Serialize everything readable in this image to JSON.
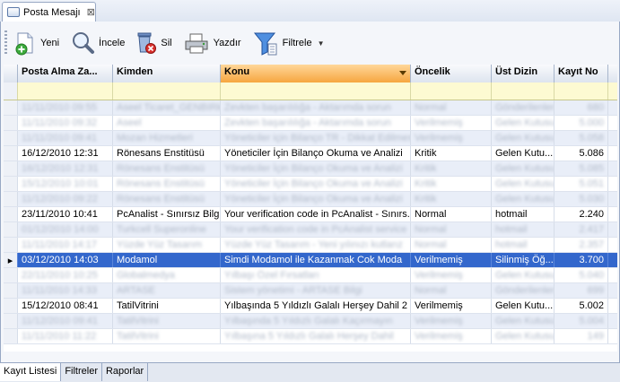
{
  "tab": {
    "title": "Posta Mesajı",
    "close": "⊠"
  },
  "toolbar": {
    "new_label": "Yeni",
    "view_label": "İncele",
    "delete_label": "Sil",
    "print_label": "Yazdır",
    "filter_label": "Filtrele",
    "dropdown_arrow": "▼"
  },
  "grid": {
    "columns": [
      "Posta Alma Za...",
      "Kimden",
      "Konu",
      "Öncelik",
      "Üst Dizin",
      "Kayıt No"
    ],
    "sorted_column": "Konu",
    "rows": [
      {
        "date": "11/11/2010 09:55",
        "from": "Aseel Ticaret_GENBIRk",
        "subject": "Zevkten başarılılığa - Aktarımda sorun",
        "priority": "Normal",
        "folder": "Gönderilenler",
        "num": "680",
        "blur": true
      },
      {
        "date": "11/11/2010 09:32",
        "from": "Aseel",
        "subject": "Zevkten başarılılığa - Aktarımda sorun",
        "priority": "Verilmemiş",
        "folder": "Gelen Kutusu",
        "num": "5.000",
        "blur": true
      },
      {
        "date": "11/11/2010 09:41",
        "from": "Mozan Hizmetleri",
        "subject": "Yöneticiler için Bilanço TR - Dikkat Edilmesi",
        "priority": "Verilmemiş",
        "folder": "Gelen Kutusu",
        "num": "5.058",
        "blur": true
      },
      {
        "date": "16/12/2010 12:31",
        "from": "Rönesans Enstitüsü",
        "subject": "Yöneticiler İçin Bilanço Okuma ve Analizi",
        "priority": "Kritik",
        "folder": "Gelen Kutu...",
        "num": "5.086",
        "blur": false
      },
      {
        "date": "16/12/2010 12:31",
        "from": "Rönesans Enstitüsü",
        "subject": "Yöneticiler İçin Bilanço Okuma ve Analizi",
        "priority": "Kritik",
        "folder": "Gelen Kutusu",
        "num": "5.085",
        "blur": true
      },
      {
        "date": "15/12/2010 10:01",
        "from": "Rönesans Enstitüsü",
        "subject": "Yöneticiler İçin Bilanço Okuma ve Analizi",
        "priority": "Kritik",
        "folder": "Gelen Kutusu",
        "num": "5.051",
        "blur": true
      },
      {
        "date": "11/12/2010 09:22",
        "from": "Rönesans Enstitüsü",
        "subject": "Yöneticiler İçin Bilanço Okuma ve Analizi",
        "priority": "Kritik",
        "folder": "Gelen Kutusu",
        "num": "5.030",
        "blur": true
      },
      {
        "date": "23/11/2010 10:41",
        "from": "PcAnalist - Sınırsız Bilg...",
        "subject": "Your verification code in PcAnalist - Sınırs...",
        "priority": "Normal",
        "folder": "hotmail",
        "num": "2.240",
        "blur": false
      },
      {
        "date": "01/12/2010 14:00",
        "from": "Turkcell Superonline",
        "subject": "Your verification code in PcAnalist service",
        "priority": "Normal",
        "folder": "hotmail",
        "num": "2.417",
        "blur": true
      },
      {
        "date": "11/11/2010 14:17",
        "from": "Yüzde Yüz Tasarım",
        "subject": "Yüzde Yüz Tasarım - Yeni yılınızı kutlarız",
        "priority": "Normal",
        "folder": "hotmail",
        "num": "2.357",
        "blur": true
      },
      {
        "date": "03/12/2010 14:03",
        "from": "Modamol",
        "subject": "Simdi Modamol ile Kazanmak Cok Moda",
        "priority": "Verilmemiş",
        "folder": "Silinmiş Öğ...",
        "num": "3.700",
        "blur": false,
        "selected": true
      },
      {
        "date": "22/11/2010 10:25",
        "from": "Globalmedya",
        "subject": "Yılbaşı Özel Fırsatları",
        "priority": "Verilmemiş",
        "folder": "Gelen Kutusu",
        "num": "5.040",
        "blur": true
      },
      {
        "date": "11/11/2010 14:33",
        "from": "ARTASE",
        "subject": "Sistem yönetimi - ARTASE Bilgi",
        "priority": "Normal",
        "folder": "Gönderilenler",
        "num": "699",
        "blur": true
      },
      {
        "date": "15/12/2010 08:41",
        "from": "TatilVitrini",
        "subject": "Yılbaşında 5 Yıldızlı Galalı Herşey Dahil 2 G...",
        "priority": "Verilmemiş",
        "folder": "Gelen Kutu...",
        "num": "5.002",
        "blur": false
      },
      {
        "date": "11/12/2010 09:41",
        "from": "TatilVitrini",
        "subject": "Yılbaşında 5 Yıldızlı Galalı Kaçırmayın",
        "priority": "Verilmemiş",
        "folder": "Gelen Kutusu",
        "num": "5.004",
        "blur": true
      },
      {
        "date": "11/11/2010 11:22",
        "from": "TatilVitrini",
        "subject": "Yılbaşına 5 Yıldızlı Galalı Herşey Dahil",
        "priority": "Verilmemiş",
        "folder": "Gelen Kutusu",
        "num": "149",
        "blur": true
      }
    ]
  },
  "bottom_tabs": [
    "Kayıt Listesi",
    "Filtreler",
    "Raporlar"
  ]
}
